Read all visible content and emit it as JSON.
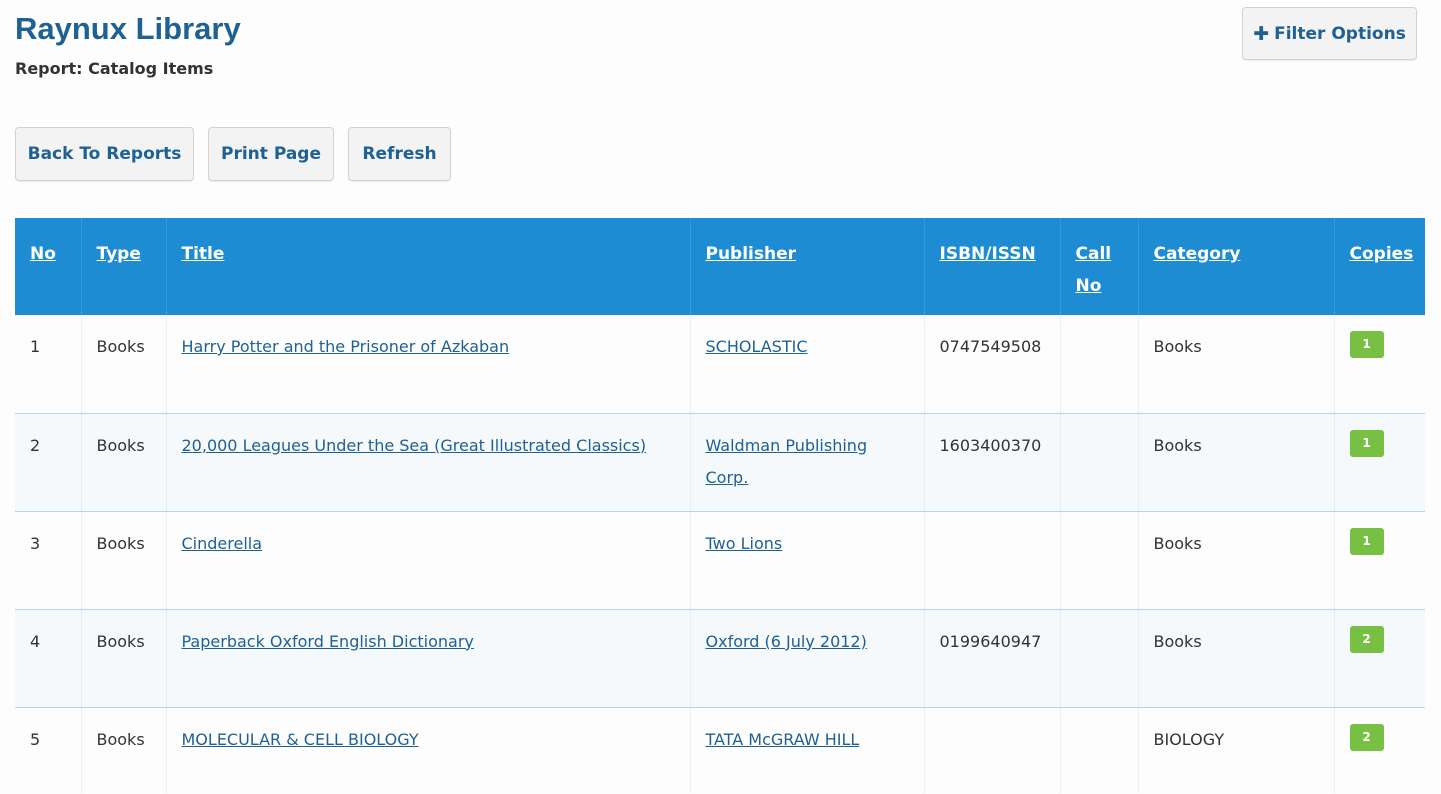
{
  "header": {
    "app_title": "Raynux Library",
    "report_subtitle": "Report: Catalog Items",
    "filter_button": {
      "icon": "plus-icon",
      "label": "Filter Options"
    }
  },
  "toolbar": {
    "back_label": "Back To Reports",
    "print_label": "Print Page",
    "refresh_label": "Refresh"
  },
  "table": {
    "columns": [
      "No",
      "Type",
      "Title",
      "Publisher",
      "ISBN/ISSN",
      "Call No",
      "Category",
      "Copies"
    ],
    "rows": [
      {
        "no": "1",
        "type": "Books",
        "title": "Harry Potter and the Prisoner of Azkaban",
        "publisher": "SCHOLASTIC",
        "isbn": "0747549508",
        "call_no": "",
        "category": "Books",
        "copies": "1"
      },
      {
        "no": "2",
        "type": "Books",
        "title": "20,000 Leagues Under the Sea (Great Illustrated Classics)",
        "publisher": "Waldman Publishing Corp.",
        "isbn": "1603400370",
        "call_no": "",
        "category": "Books",
        "copies": "1"
      },
      {
        "no": "3",
        "type": "Books",
        "title": "Cinderella",
        "publisher": "Two Lions",
        "isbn": "",
        "call_no": "",
        "category": "Books",
        "copies": "1"
      },
      {
        "no": "4",
        "type": "Books",
        "title": "Paperback Oxford English Dictionary",
        "publisher": "Oxford (6 July 2012)",
        "isbn": "0199640947",
        "call_no": "",
        "category": "Books",
        "copies": "2"
      },
      {
        "no": "5",
        "type": "Books",
        "title": "MOLECULAR & CELL BIOLOGY",
        "publisher": "TATA McGRAW HILL",
        "isbn": "",
        "call_no": "",
        "category": "BIOLOGY",
        "copies": "2"
      }
    ]
  },
  "colors": {
    "title": "#1f6193",
    "header_bg": "#1e8cd3",
    "badge": "#78c043",
    "link": "#1f6193"
  }
}
